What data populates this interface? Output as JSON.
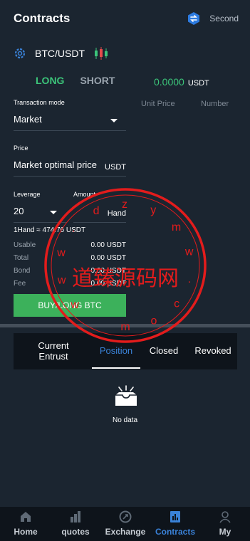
{
  "header": {
    "title": "Contracts",
    "mode_label": "Second"
  },
  "pair": {
    "name": "BTC/USDT"
  },
  "tabs": {
    "long": "LONG",
    "short": "SHORT"
  },
  "price": {
    "value": "0.0000",
    "unit": "USDT"
  },
  "labels": {
    "transaction_mode": "Transaction mode",
    "unit_price": "Unit Price",
    "number": "Number",
    "price": "Price",
    "leverage": "Leverage",
    "amount": "Amount"
  },
  "fields": {
    "mode_value": "Market",
    "price_value": "Market optimal price",
    "price_unit": "USDT",
    "leverage_value": "20",
    "amount_unit": "Hand"
  },
  "hand_equivalent": "1Hand ≈ 474.76 USDT",
  "stats": [
    {
      "label": "Usable",
      "value": "0.00 USDT"
    },
    {
      "label": "Total",
      "value": "0.00 USDT"
    },
    {
      "label": "Bond",
      "value": "0.00 USDT"
    },
    {
      "label": "Fee",
      "value": "0.00 USDT"
    }
  ],
  "buy_button": "BUY/LONG BTC",
  "order_tabs": {
    "current_line1": "Current",
    "current_line2": "Entrust",
    "position": "Position",
    "closed": "Closed",
    "revoked": "Revoked"
  },
  "empty": "No data",
  "nav": {
    "home": "Home",
    "quotes": "quotes",
    "exchange": "Exchange",
    "contracts": "Contracts",
    "my": "My"
  },
  "watermark": {
    "main": "道臻源码网",
    "chars": [
      "w",
      "w",
      "w",
      ".",
      "d",
      "z",
      "y",
      "m",
      "w",
      ".",
      "c",
      "o",
      "m"
    ]
  },
  "colors": {
    "background": "#1b2530",
    "accent_green": "#3cc57a",
    "buy_green": "#3cb15b",
    "accent_blue": "#3a82d8",
    "watermark_red": "#e31c1c"
  },
  "icons": {
    "mode": "switch-icon",
    "settings": "gear-icon",
    "candles": "candlestick-icon",
    "empty": "empty-box-icon"
  }
}
